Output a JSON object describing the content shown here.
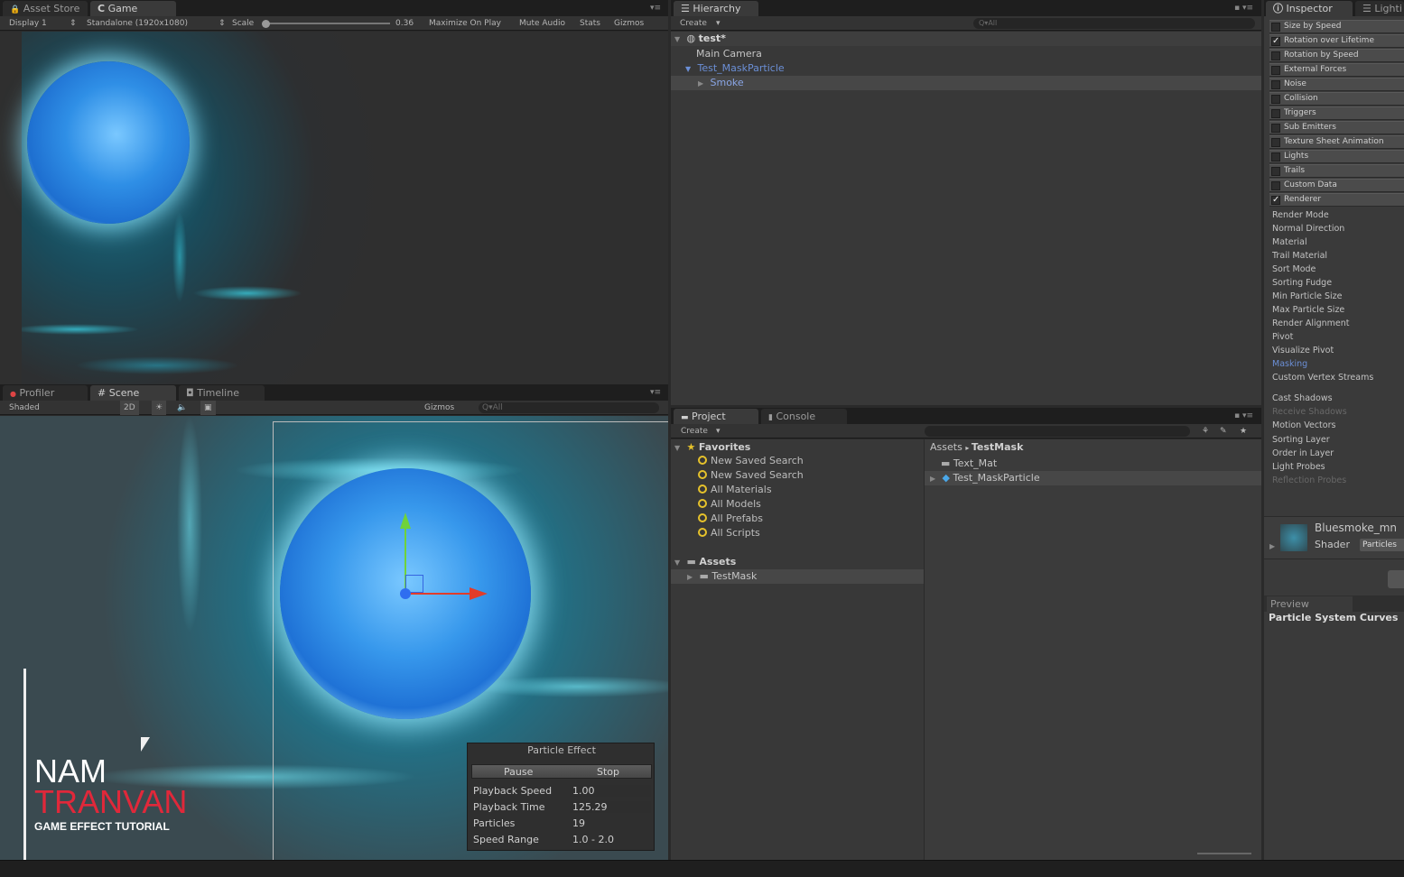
{
  "game": {
    "tabs": [
      "Asset Store",
      "Game"
    ],
    "toolbar": {
      "display": "Display 1",
      "resolution": "Standalone (1920x1080)",
      "scale_label": "Scale",
      "scale_value": "0.36",
      "maximize": "Maximize On Play",
      "mute": "Mute Audio",
      "stats": "Stats",
      "gizmos": "Gizmos"
    }
  },
  "hierarchy": {
    "tab": "Hierarchy",
    "create": "Create",
    "search_placeholder": "Q▾All",
    "scene": "test*",
    "items": [
      "Main Camera",
      "Test_MaskParticle",
      "Smoke"
    ]
  },
  "inspector": {
    "tab": "Inspector",
    "tab2": "Lighti",
    "modules": [
      {
        "label": "Size by Speed",
        "checked": ""
      },
      {
        "label": "Rotation over Lifetime",
        "checked": "✓"
      },
      {
        "label": "Rotation by Speed",
        "checked": ""
      },
      {
        "label": "External Forces",
        "checked": ""
      },
      {
        "label": "Noise",
        "checked": ""
      },
      {
        "label": "Collision",
        "checked": ""
      },
      {
        "label": "Triggers",
        "checked": ""
      },
      {
        "label": "Sub Emitters",
        "checked": ""
      },
      {
        "label": "Texture Sheet Animation",
        "checked": ""
      },
      {
        "label": "Lights",
        "checked": ""
      },
      {
        "label": "Trails",
        "checked": ""
      },
      {
        "label": "Custom Data",
        "checked": ""
      },
      {
        "label": "Renderer",
        "checked": "✓"
      }
    ],
    "renderer_props": [
      "Render Mode",
      "Normal Direction",
      "Material",
      "Trail Material",
      "Sort Mode",
      "Sorting Fudge",
      "Min Particle Size",
      "Max Particle Size",
      "Render Alignment",
      "Pivot",
      "Visualize Pivot",
      "Masking",
      "Custom Vertex Streams"
    ],
    "shadow_props": [
      "Cast Shadows",
      "Receive Shadows",
      "Motion Vectors",
      "Sorting Layer",
      "Order in Layer",
      "Light Probes",
      "Reflection Probes"
    ],
    "material_name": "Bluesmoke_mn",
    "shader_label": "Shader",
    "shader_value": "Particles",
    "preview_tab": "Preview",
    "preview_title": "Particle System Curves"
  },
  "scene": {
    "tabs": [
      "Profiler",
      "Scene",
      "Timeline"
    ],
    "toolbar": {
      "shading": "Shaded",
      "mode2d": "2D",
      "gizmos": "Gizmos",
      "search": "Q▾All"
    }
  },
  "particle_effect": {
    "title": "Particle Effect",
    "pause": "Pause",
    "stop": "Stop",
    "rows": [
      {
        "label": "Playback Speed",
        "value": "1.00"
      },
      {
        "label": "Playback Time",
        "value": "125.29"
      },
      {
        "label": "Particles",
        "value": "19"
      },
      {
        "label": "Speed Range",
        "value": "1.0 - 2.0"
      }
    ]
  },
  "watermark": {
    "line1": "NAM",
    "line2": "TRANVAN",
    "line3": "GAME EFFECT TUTORIAL"
  },
  "project": {
    "tabs": [
      "Project",
      "Console"
    ],
    "create": "Create",
    "favorites_label": "Favorites",
    "favorites": [
      "New Saved Search",
      "New Saved Search",
      "All Materials",
      "All Models",
      "All Prefabs",
      "All Scripts"
    ],
    "assets_label": "Assets",
    "asset_folders": [
      "TestMask"
    ],
    "breadcrumb_root": "Assets",
    "breadcrumb_current": "TestMask",
    "files": [
      "Text_Mat",
      "Test_MaskParticle"
    ]
  },
  "colors": {
    "accent_blue": "#6b8fd6",
    "favorite_yellow": "#e6c22b",
    "watermark_red": "#e0283a"
  }
}
